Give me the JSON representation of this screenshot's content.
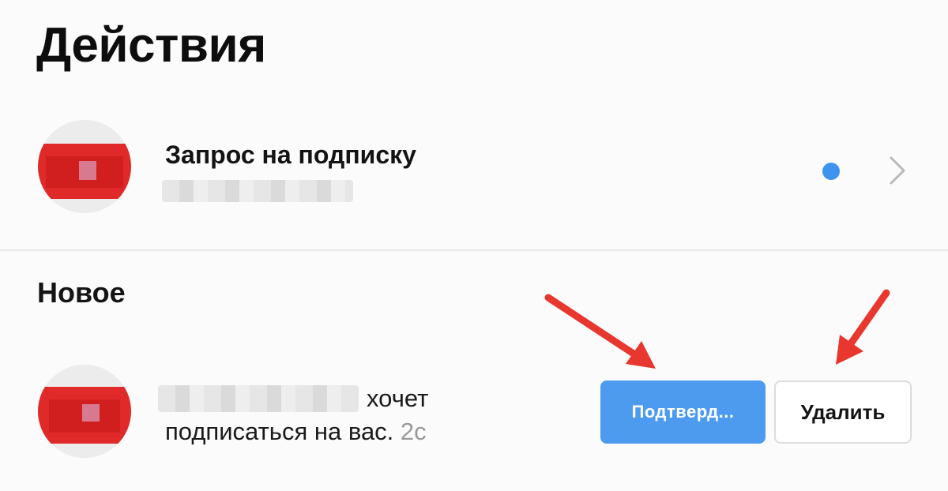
{
  "header": {
    "title": "Действия"
  },
  "follow_requests": {
    "title": "Запрос на подписку",
    "has_unread": true,
    "accent_color": "#3d93ef"
  },
  "sections": {
    "new": {
      "title": "Новое"
    }
  },
  "notification": {
    "text_part1": "хочет",
    "text_part2": "подписаться на вас.",
    "time": "2с",
    "confirm_label": "Подтверд...",
    "delete_label": "Удалить",
    "confirm_color": "#4d9bef"
  },
  "icons": {
    "unread": "unread-dot-icon",
    "chevron": "chevron-right-icon",
    "annotation": "red-arrow-icon"
  }
}
